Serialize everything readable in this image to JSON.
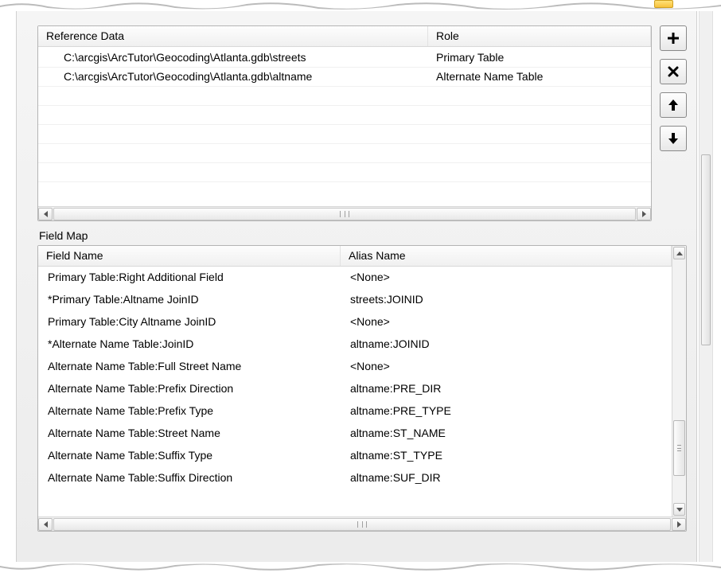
{
  "reference_data": {
    "columns": [
      "Reference Data",
      "Role"
    ],
    "rows": [
      {
        "path": "C:\\arcgis\\ArcTutor\\Geocoding\\Atlanta.gdb\\streets",
        "role": "Primary Table"
      },
      {
        "path": "C:\\arcgis\\ArcTutor\\Geocoding\\Atlanta.gdb\\altname",
        "role": "Alternate Name Table"
      }
    ]
  },
  "field_map": {
    "label": "Field Map",
    "columns": [
      "Field Name",
      "Alias Name"
    ],
    "rows": [
      {
        "field": "Primary Table:Right Additional Field",
        "alias": "<None>"
      },
      {
        "field": "*Primary Table:Altname JoinID",
        "alias": "streets:JOINID"
      },
      {
        "field": "Primary Table:City Altname JoinID",
        "alias": "<None>"
      },
      {
        "field": "*Alternate Name Table:JoinID",
        "alias": "altname:JOINID"
      },
      {
        "field": "Alternate Name Table:Full Street Name",
        "alias": "<None>"
      },
      {
        "field": "Alternate Name Table:Prefix Direction",
        "alias": "altname:PRE_DIR"
      },
      {
        "field": "Alternate Name Table:Prefix Type",
        "alias": "altname:PRE_TYPE"
      },
      {
        "field": "Alternate Name Table:Street Name",
        "alias": "altname:ST_NAME"
      },
      {
        "field": "Alternate Name Table:Suffix Type",
        "alias": "altname:ST_TYPE"
      },
      {
        "field": "Alternate Name Table:Suffix Direction",
        "alias": "altname:SUF_DIR"
      }
    ]
  }
}
